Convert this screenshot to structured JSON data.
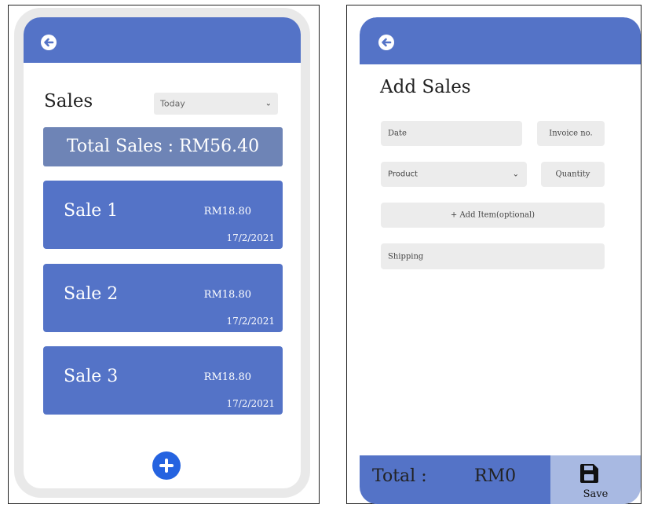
{
  "sales_screen": {
    "title": "Sales",
    "filter": {
      "selected": "Today"
    },
    "total_text": "Total Sales : RM56.40",
    "sales": [
      {
        "name": "Sale 1",
        "amount": "RM18.80",
        "date": "17/2/2021"
      },
      {
        "name": "Sale 2",
        "amount": "RM18.80",
        "date": "17/2/2021"
      },
      {
        "name": "Sale 3",
        "amount": "RM18.80",
        "date": "17/2/2021"
      }
    ]
  },
  "add_screen": {
    "title": "Add Sales",
    "fields": {
      "date": "Date",
      "invoice": "Invoice no.",
      "product": "Product",
      "quantity": "Quantity",
      "add_item": "+ Add Item(optional)",
      "shipping": "Shipping"
    },
    "footer": {
      "total_label": "Total :",
      "total_value": "RM0",
      "save_label": "Save"
    }
  },
  "colors": {
    "primary": "#5473c7",
    "total_box": "#6e84b6",
    "save_bg": "#a8b9e2",
    "add_button": "#2563e0",
    "field_bg": "#ececec"
  },
  "icons": [
    "back-arrow-icon",
    "chevron-down-icon",
    "plus-icon",
    "save-icon"
  ]
}
